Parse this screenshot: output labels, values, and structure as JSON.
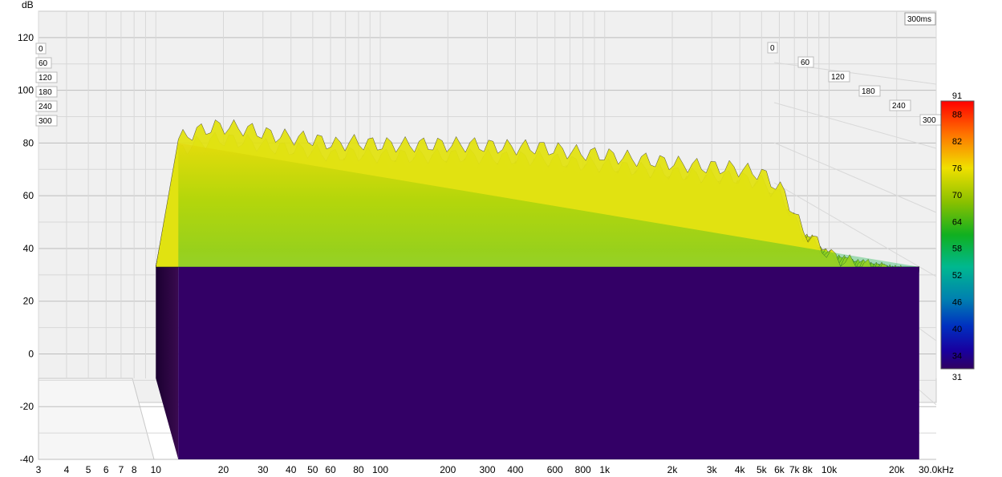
{
  "chart_data": {
    "type": "waterfall",
    "title": "",
    "ylabel": "dB",
    "xlabel": "",
    "x_unit_suffix": "kHz",
    "time_badge": "300ms",
    "x_scale": "log",
    "xlim": [
      3,
      30000
    ],
    "ylim": [
      -40,
      130
    ],
    "zlim_ms": [
      0,
      300
    ],
    "grid": true,
    "y_ticks": [
      120,
      100,
      80,
      60,
      40,
      20,
      0,
      -20,
      -40
    ],
    "x_ticks": [
      {
        "v": 3,
        "label": "3"
      },
      {
        "v": 4,
        "label": "4"
      },
      {
        "v": 5,
        "label": "5"
      },
      {
        "v": 6,
        "label": "6"
      },
      {
        "v": 7,
        "label": "7"
      },
      {
        "v": 8,
        "label": "8"
      },
      {
        "v": 10,
        "label": "10"
      },
      {
        "v": 20,
        "label": "20"
      },
      {
        "v": 30,
        "label": "30"
      },
      {
        "v": 40,
        "label": "40"
      },
      {
        "v": 50,
        "label": "50"
      },
      {
        "v": 60,
        "label": "60"
      },
      {
        "v": 80,
        "label": "80"
      },
      {
        "v": 100,
        "label": "100"
      },
      {
        "v": 200,
        "label": "200"
      },
      {
        "v": 300,
        "label": "300"
      },
      {
        "v": 400,
        "label": "400"
      },
      {
        "v": 600,
        "label": "600"
      },
      {
        "v": 800,
        "label": "800"
      },
      {
        "v": 1000,
        "label": "1k"
      },
      {
        "v": 2000,
        "label": "2k"
      },
      {
        "v": 3000,
        "label": "3k"
      },
      {
        "v": 4000,
        "label": "4k"
      },
      {
        "v": 5000,
        "label": "5k"
      },
      {
        "v": 6000,
        "label": "6k"
      },
      {
        "v": 7000,
        "label": "7k"
      },
      {
        "v": 8000,
        "label": "8k"
      },
      {
        "v": 10000,
        "label": "10k"
      },
      {
        "v": 20000,
        "label": "20k"
      },
      {
        "v": 30000,
        "label": "30.0kHz"
      }
    ],
    "time_ticks_right": [
      "0",
      "60",
      "120",
      "180",
      "240",
      "300"
    ],
    "time_ticks_left": [
      "0",
      "60",
      "120",
      "180",
      "240",
      "300"
    ],
    "colorbar": {
      "min": 31,
      "max": 91,
      "labels": [
        91,
        88,
        82,
        76,
        70,
        64,
        58,
        52,
        46,
        40,
        34,
        31
      ]
    },
    "noise_floor_db": 33,
    "series": [
      {
        "slice_ms": 0,
        "freq_hz": [
          10,
          12,
          15,
          20,
          25,
          30,
          40,
          50,
          60,
          80,
          100,
          150,
          200,
          300,
          400,
          600,
          800,
          1000,
          2000,
          3000,
          4000,
          5000,
          6000,
          8000,
          10000,
          15000,
          20000
        ],
        "db": [
          86,
          89,
          91,
          90,
          88,
          87,
          86,
          84,
          85,
          84,
          84,
          84,
          84,
          83,
          83,
          81,
          80,
          79,
          76,
          75,
          73,
          66,
          52,
          42,
          39,
          36,
          34
        ]
      },
      {
        "slice_ms": 300,
        "freq_hz": [
          10,
          20,
          40,
          100,
          200,
          1000,
          3000,
          6000,
          10000,
          20000
        ],
        "db": [
          33,
          33,
          33,
          33,
          33,
          33,
          33,
          33,
          33,
          33
        ]
      }
    ]
  }
}
